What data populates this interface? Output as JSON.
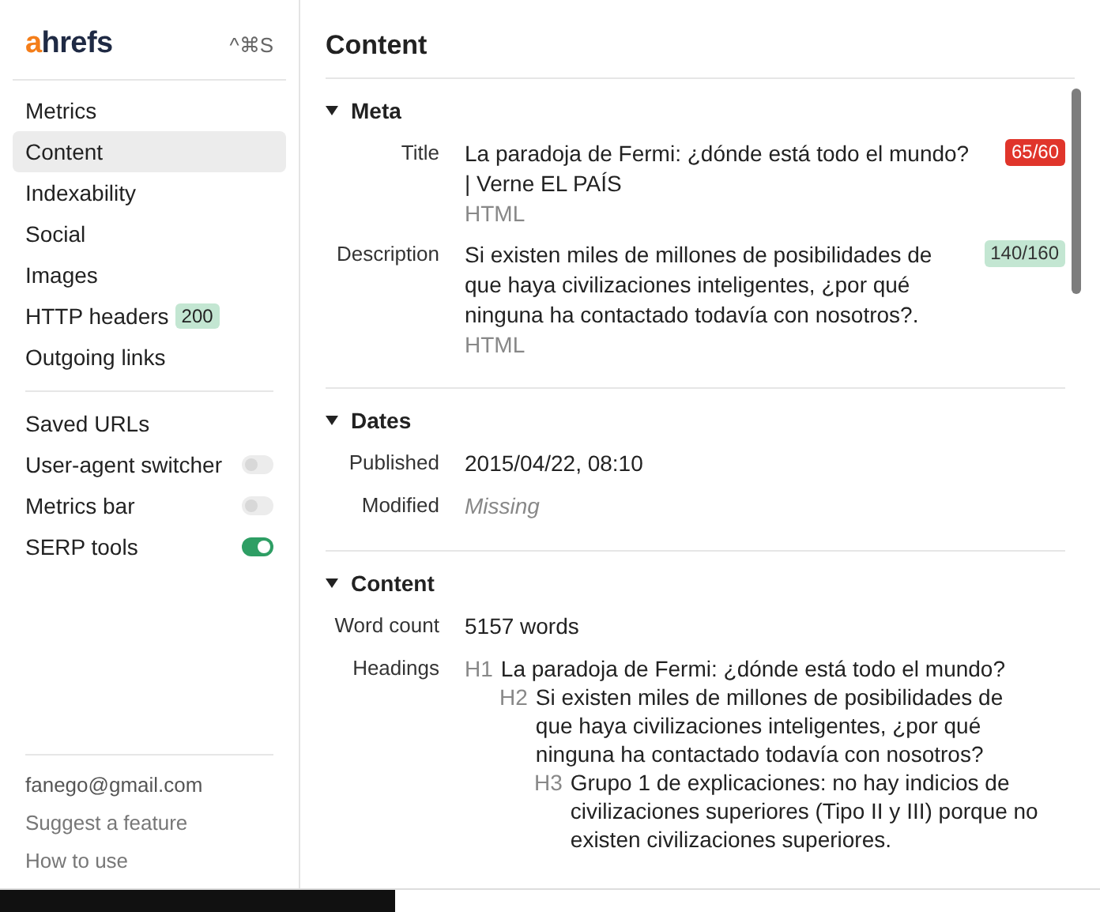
{
  "sidebar": {
    "logo": {
      "accent": "a",
      "rest": "hrefs"
    },
    "shortcut": "^⌘S",
    "nav": [
      {
        "label": "Metrics",
        "selected": false
      },
      {
        "label": "Content",
        "selected": true
      },
      {
        "label": "Indexability",
        "selected": false
      },
      {
        "label": "Social",
        "selected": false
      },
      {
        "label": "Images",
        "selected": false
      },
      {
        "label": "HTTP headers",
        "selected": false,
        "badge": "200"
      },
      {
        "label": "Outgoing links",
        "selected": false
      }
    ],
    "tools": [
      {
        "label": "Saved URLs",
        "kind": "link"
      },
      {
        "label": "User-agent switcher",
        "kind": "toggle",
        "on": false
      },
      {
        "label": "Metrics bar",
        "kind": "toggle",
        "on": false
      },
      {
        "label": "SERP tools",
        "kind": "toggle",
        "on": true
      }
    ],
    "footer": [
      "fanego@gmail.com",
      "Suggest a feature",
      "How to use"
    ]
  },
  "panel": {
    "title": "Content",
    "sections": [
      {
        "title": "Meta",
        "expanded": true,
        "rows": [
          {
            "kind": "text",
            "label": "Title",
            "value": "La paradoja de Fermi: ¿dónde está todo el mundo? | Verne EL PAÍS",
            "source": "HTML",
            "count": "65/60",
            "over_limit": true
          },
          {
            "kind": "text",
            "label": "Description",
            "value": "Si existen miles de millones de posibilidades de que haya civilizaciones inteligentes, ¿por qué ninguna ha contactado todavía con nosotros?.",
            "source": "HTML",
            "count": "140/160",
            "over_limit": false
          }
        ]
      },
      {
        "title": "Dates",
        "expanded": true,
        "rows": [
          {
            "kind": "text",
            "label": "Published",
            "value": "2015/04/22, 08:10"
          },
          {
            "kind": "missing",
            "label": "Modified",
            "value": "Missing"
          }
        ]
      },
      {
        "title": "Content",
        "expanded": true,
        "rows": [
          {
            "kind": "text",
            "label": "Word count",
            "value": "5157 words"
          },
          {
            "kind": "headings",
            "label": "Headings",
            "headings": [
              {
                "level": "H1",
                "text": "La paradoja de Fermi: ¿dónde está todo el mundo?",
                "children": [
                  {
                    "level": "H2",
                    "text": "Si existen miles de millones de posibilidades de que haya civilizaciones inteligentes, ¿por qué ninguna ha contactado todavía con nosotros?",
                    "children": [
                      {
                        "level": "H3",
                        "text": "Grupo 1 de explicaciones: no hay indicios de civilizaciones superiores (Tipo II y III) porque no existen civilizaciones superiores."
                      }
                    ]
                  }
                ]
              }
            ]
          }
        ]
      }
    ]
  }
}
